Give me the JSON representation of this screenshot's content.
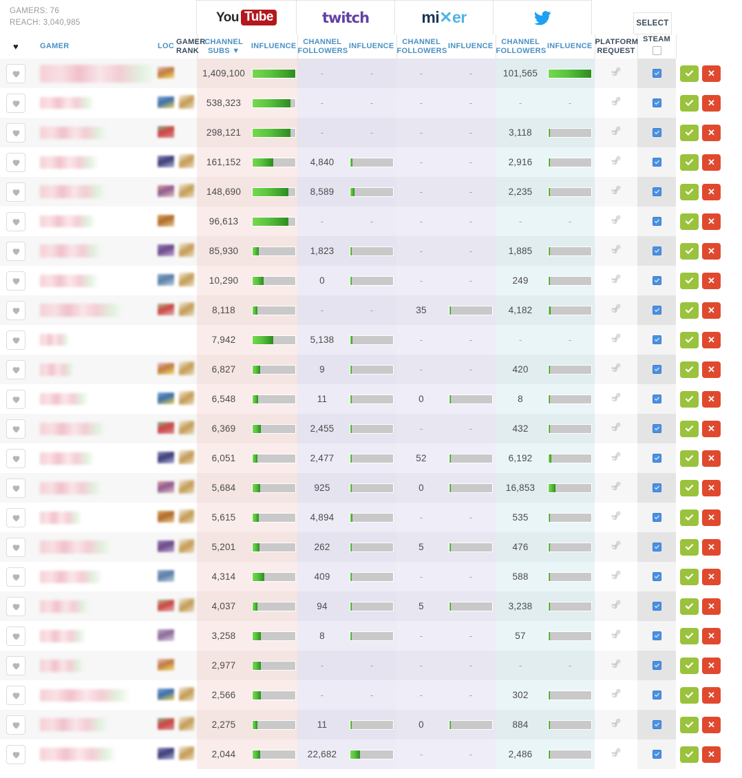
{
  "summary": {
    "gamers_label": "GAMERS: 76",
    "reach_label": "REACH: 3,040,985"
  },
  "platforms": [
    {
      "id": "youtube",
      "name": "YouTube",
      "logo": "youtube-logo",
      "metric_label": "CHANNEL SUBS",
      "influence_label": "INFLUENCE",
      "sorted": true,
      "sort_glyph": "▼"
    },
    {
      "id": "twitch",
      "name": "Twitch",
      "logo": "twitch-logo",
      "metric_label": "CHANNEL FOLLOWERS",
      "influence_label": "INFLUENCE",
      "sorted": false,
      "sort_glyph": ""
    },
    {
      "id": "mixer",
      "name": "Mixer",
      "logo": "mixer-logo",
      "metric_label": "CHANNEL FOLLOWERS",
      "influence_label": "INFLUENCE",
      "sorted": false,
      "sort_glyph": ""
    },
    {
      "id": "twitter",
      "name": "Twitter",
      "logo": "twitter-logo",
      "metric_label": "CHANNEL FOLLOWERS",
      "influence_label": "INFLUENCE",
      "sorted": false,
      "sort_glyph": ""
    }
  ],
  "headers": {
    "heart": "♥",
    "gamer": "GAMER",
    "loc": "LOC",
    "gamer_rank": "GAMER RANK",
    "platform_request": "PLATFORM REQUEST",
    "select": "SELECT",
    "steam": "STEAM",
    "yt_metric_line1": "CHANNEL",
    "yt_metric_line2": "SUBS ▼",
    "metric_line1": "CHANNEL",
    "metric_line2": "FOLLOWERS",
    "influence": "INFLUENCE",
    "platform_request_l1": "PLATFORM",
    "platform_request_l2": "REQUEST"
  },
  "colors": {
    "accent_link": "#4a90c4",
    "youtube_tint": "#f7e8e6",
    "twitch_tint": "#ebe9f4",
    "mixer_tint": "#ecebf6",
    "twitter_tint": "#e6f1f3",
    "bar_green_light": "#78d84e",
    "bar_green_dark": "#2f8b20",
    "bar_track": "#c9c9c9",
    "approve_green": "#9ac23c",
    "reject_red": "#e0492e",
    "checkbox_blue": "#4a90e2"
  },
  "rows": [
    {
      "yt": "1,409,100",
      "yt_inf": 100,
      "tw": "-",
      "tw_inf": null,
      "mx": "-",
      "mx_inf": null,
      "tt": "101,565",
      "tt_inf": 100,
      "steam_checked": true,
      "flag": "flag-redacted",
      "rank": "",
      "name": "redacted",
      "name_w": 172,
      "name_h": 26
    },
    {
      "yt": "538,323",
      "yt_inf": 88,
      "tw": "-",
      "tw_inf": null,
      "mx": "-",
      "mx_inf": null,
      "tt": "-",
      "tt_inf": null,
      "steam_checked": true,
      "flag": "flag-redacted",
      "rank": "rank-redacted",
      "name": "redacted",
      "name_w": 78,
      "name_h": 17
    },
    {
      "yt": "298,121",
      "yt_inf": 88,
      "tw": "-",
      "tw_inf": null,
      "mx": "-",
      "mx_inf": null,
      "tt": "3,118",
      "tt_inf": 4,
      "steam_checked": true,
      "flag": "flag-redacted",
      "rank": "",
      "name": "redacted",
      "name_w": 98,
      "name_h": 18
    },
    {
      "yt": "161,152",
      "yt_inf": 48,
      "tw": "4,840",
      "tw_inf": 5,
      "mx": "-",
      "mx_inf": null,
      "tt": "2,916",
      "tt_inf": 4,
      "steam_checked": true,
      "flag": "flag-redacted",
      "rank": "rank-redacted",
      "name": "redacted",
      "name_w": 84,
      "name_h": 18
    },
    {
      "yt": "148,690",
      "yt_inf": 84,
      "tw": "8,589",
      "tw_inf": 9,
      "mx": "-",
      "mx_inf": null,
      "tt": "2,235",
      "tt_inf": 4,
      "steam_checked": true,
      "flag": "flag-redacted",
      "rank": "rank-redacted",
      "name": "redacted",
      "name_w": 96,
      "name_h": 19
    },
    {
      "yt": "96,613",
      "yt_inf": 84,
      "tw": "-",
      "tw_inf": null,
      "mx": "-",
      "mx_inf": null,
      "tt": "-",
      "tt_inf": null,
      "steam_checked": true,
      "flag": "flag-redacted",
      "rank": "",
      "name": "redacted",
      "name_w": 80,
      "name_h": 17
    },
    {
      "yt": "85,930",
      "yt_inf": 14,
      "tw": "1,823",
      "tw_inf": 2,
      "mx": "-",
      "mx_inf": null,
      "tt": "1,885",
      "tt_inf": 3,
      "steam_checked": true,
      "flag": "flag-redacted",
      "rank": "rank-redacted",
      "name": "redacted",
      "name_w": 90,
      "name_h": 19
    },
    {
      "yt": "10,290",
      "yt_inf": 26,
      "tw": "0",
      "tw_inf": 0,
      "mx": "-",
      "mx_inf": null,
      "tt": "249",
      "tt_inf": 0,
      "steam_checked": true,
      "flag": "flag-redacted",
      "rank": "rank-redacted",
      "name": "redacted",
      "name_w": 84,
      "name_h": 18
    },
    {
      "yt": "8,118",
      "yt_inf": 11,
      "tw": "-",
      "tw_inf": null,
      "mx": "35",
      "mx_inf": 0,
      "tt": "4,182",
      "tt_inf": 5,
      "steam_checked": true,
      "flag": "flag-redacted",
      "rank": "rank-redacted",
      "name": "redacted",
      "name_w": 120,
      "name_h": 19
    },
    {
      "yt": "7,942",
      "yt_inf": 48,
      "tw": "5,138",
      "tw_inf": 5,
      "mx": "-",
      "mx_inf": null,
      "tt": "-",
      "tt_inf": null,
      "steam_checked": true,
      "flag": "",
      "rank": "",
      "name": "redacted",
      "name_w": 42,
      "name_h": 17
    },
    {
      "yt": "6,827",
      "yt_inf": 18,
      "tw": "9",
      "tw_inf": 0,
      "mx": "-",
      "mx_inf": null,
      "tt": "420",
      "tt_inf": 3,
      "steam_checked": true,
      "flag": "flag-redacted",
      "rank": "rank-redacted",
      "name": "redacted",
      "name_w": 50,
      "name_h": 18
    },
    {
      "yt": "6,548",
      "yt_inf": 13,
      "tw": "11",
      "tw_inf": 0,
      "mx": "0",
      "mx_inf": 0,
      "tt": "8",
      "tt_inf": 0,
      "steam_checked": true,
      "flag": "flag-redacted",
      "rank": "rank-redacted",
      "name": "redacted",
      "name_w": 70,
      "name_h": 17
    },
    {
      "yt": "6,369",
      "yt_inf": 20,
      "tw": "2,455",
      "tw_inf": 3,
      "mx": "-",
      "mx_inf": null,
      "tt": "432",
      "tt_inf": 3,
      "steam_checked": true,
      "flag": "flag-redacted",
      "rank": "rank-redacted",
      "name": "redacted",
      "name_w": 96,
      "name_h": 18
    },
    {
      "yt": "6,051",
      "yt_inf": 12,
      "tw": "2,477",
      "tw_inf": 3,
      "mx": "52",
      "mx_inf": 0,
      "tt": "6,192",
      "tt_inf": 6,
      "steam_checked": true,
      "flag": "flag-redacted",
      "rank": "rank-redacted",
      "name": "redacted",
      "name_w": 78,
      "name_h": 18
    },
    {
      "yt": "5,684",
      "yt_inf": 18,
      "tw": "925",
      "tw_inf": 0,
      "mx": "0",
      "mx_inf": 0,
      "tt": "16,853",
      "tt_inf": 16,
      "steam_checked": true,
      "flag": "flag-redacted",
      "rank": "rank-redacted",
      "name": "redacted",
      "name_w": 90,
      "name_h": 18
    },
    {
      "yt": "5,615",
      "yt_inf": 14,
      "tw": "4,894",
      "tw_inf": 5,
      "mx": "-",
      "mx_inf": null,
      "tt": "535",
      "tt_inf": 3,
      "steam_checked": true,
      "flag": "flag-redacted",
      "rank": "rank-redacted",
      "name": "redacted",
      "name_w": 60,
      "name_h": 18
    },
    {
      "yt": "5,201",
      "yt_inf": 16,
      "tw": "262",
      "tw_inf": 0,
      "mx": "5",
      "mx_inf": 0,
      "tt": "476",
      "tt_inf": 3,
      "steam_checked": true,
      "flag": "flag-redacted",
      "rank": "rank-redacted",
      "name": "redacted",
      "name_w": 104,
      "name_h": 19
    },
    {
      "yt": "4,314",
      "yt_inf": 27,
      "tw": "409",
      "tw_inf": 0,
      "mx": "-",
      "mx_inf": null,
      "tt": "588",
      "tt_inf": 3,
      "steam_checked": true,
      "flag": "flag-redacted",
      "rank": "",
      "name": "redacted",
      "name_w": 90,
      "name_h": 18
    },
    {
      "yt": "4,037",
      "yt_inf": 11,
      "tw": "94",
      "tw_inf": 0,
      "mx": "5",
      "mx_inf": 0,
      "tt": "3,238",
      "tt_inf": 4,
      "steam_checked": true,
      "flag": "flag-redacted",
      "rank": "rank-redacted",
      "name": "redacted",
      "name_w": 72,
      "name_h": 18
    },
    {
      "yt": "3,258",
      "yt_inf": 20,
      "tw": "8",
      "tw_inf": 0,
      "mx": "-",
      "mx_inf": null,
      "tt": "57",
      "tt_inf": 0,
      "steam_checked": true,
      "flag": "flag-redacted",
      "rank": "",
      "name": "redacted",
      "name_w": 66,
      "name_h": 18
    },
    {
      "yt": "2,977",
      "yt_inf": 20,
      "tw": "-",
      "tw_inf": null,
      "mx": "-",
      "mx_inf": null,
      "tt": "-",
      "tt_inf": null,
      "steam_checked": true,
      "flag": "flag-redacted",
      "rank": "",
      "name": "redacted",
      "name_w": 64,
      "name_h": 18
    },
    {
      "yt": "2,566",
      "yt_inf": 20,
      "tw": "-",
      "tw_inf": null,
      "mx": "-",
      "mx_inf": null,
      "tt": "302",
      "tt_inf": 0,
      "steam_checked": true,
      "flag": "flag-redacted",
      "rank": "rank-redacted",
      "name": "redacted",
      "name_w": 130,
      "name_h": 18
    },
    {
      "yt": "2,275",
      "yt_inf": 11,
      "tw": "11",
      "tw_inf": 0,
      "mx": "0",
      "mx_inf": 0,
      "tt": "884",
      "tt_inf": 3,
      "steam_checked": true,
      "flag": "flag-redacted",
      "rank": "rank-redacted",
      "name": "redacted",
      "name_w": 100,
      "name_h": 19
    },
    {
      "yt": "2,044",
      "yt_inf": 18,
      "tw": "22,682",
      "tw_inf": 23,
      "mx": "-",
      "mx_inf": null,
      "tt": "2,486",
      "tt_inf": 3,
      "steam_checked": true,
      "flag": "flag-redacted",
      "rank": "rank-redacted",
      "name": "redacted",
      "name_w": 110,
      "name_h": 19
    }
  ],
  "actions": {
    "approve_label": "✔",
    "reject_label": "✖",
    "approve_name": "approve-button",
    "reject_name": "reject-button"
  },
  "icons": {
    "heart": "♥",
    "steam": "steam-icon",
    "check": "check-icon",
    "cross": "cross-icon"
  }
}
